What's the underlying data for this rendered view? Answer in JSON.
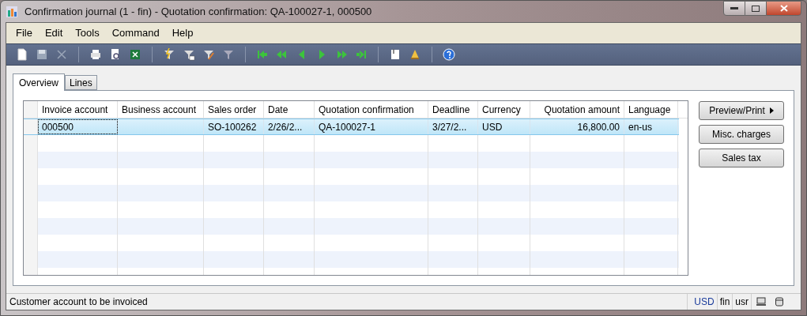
{
  "window": {
    "title": "Confirmation journal (1 - fin) - Quotation confirmation: QA-100027-1, 000500"
  },
  "menu": [
    "File",
    "Edit",
    "Tools",
    "Command",
    "Help"
  ],
  "tabs": [
    {
      "label": "Overview",
      "selected": true
    },
    {
      "label": "Lines",
      "selected": false
    }
  ],
  "table": {
    "columns": [
      {
        "label": "Invoice account"
      },
      {
        "label": "Business account"
      },
      {
        "label": "Sales order"
      },
      {
        "label": "Date"
      },
      {
        "label": "Quotation confirmation"
      },
      {
        "label": "Deadline"
      },
      {
        "label": "Currency"
      },
      {
        "label": "Quotation amount"
      },
      {
        "label": "Language"
      }
    ],
    "rows": [
      {
        "selected": true,
        "cells": [
          "000500",
          "",
          "SO-100262",
          "2/26/2...",
          "QA-100027-1",
          "3/27/2...",
          "USD",
          "16,800.00",
          "en-us"
        ]
      }
    ]
  },
  "buttons": [
    {
      "label": "Preview/Print",
      "has_submenu": true
    },
    {
      "label": "Misc. charges",
      "has_submenu": false
    },
    {
      "label": "Sales tax",
      "has_submenu": false
    }
  ],
  "status_bar": {
    "message": "Customer account to be invoiced",
    "fields": [
      {
        "text": "USD",
        "highlight": true
      },
      {
        "text": "fin",
        "highlight": false
      },
      {
        "text": "usr",
        "highlight": false
      }
    ]
  }
}
